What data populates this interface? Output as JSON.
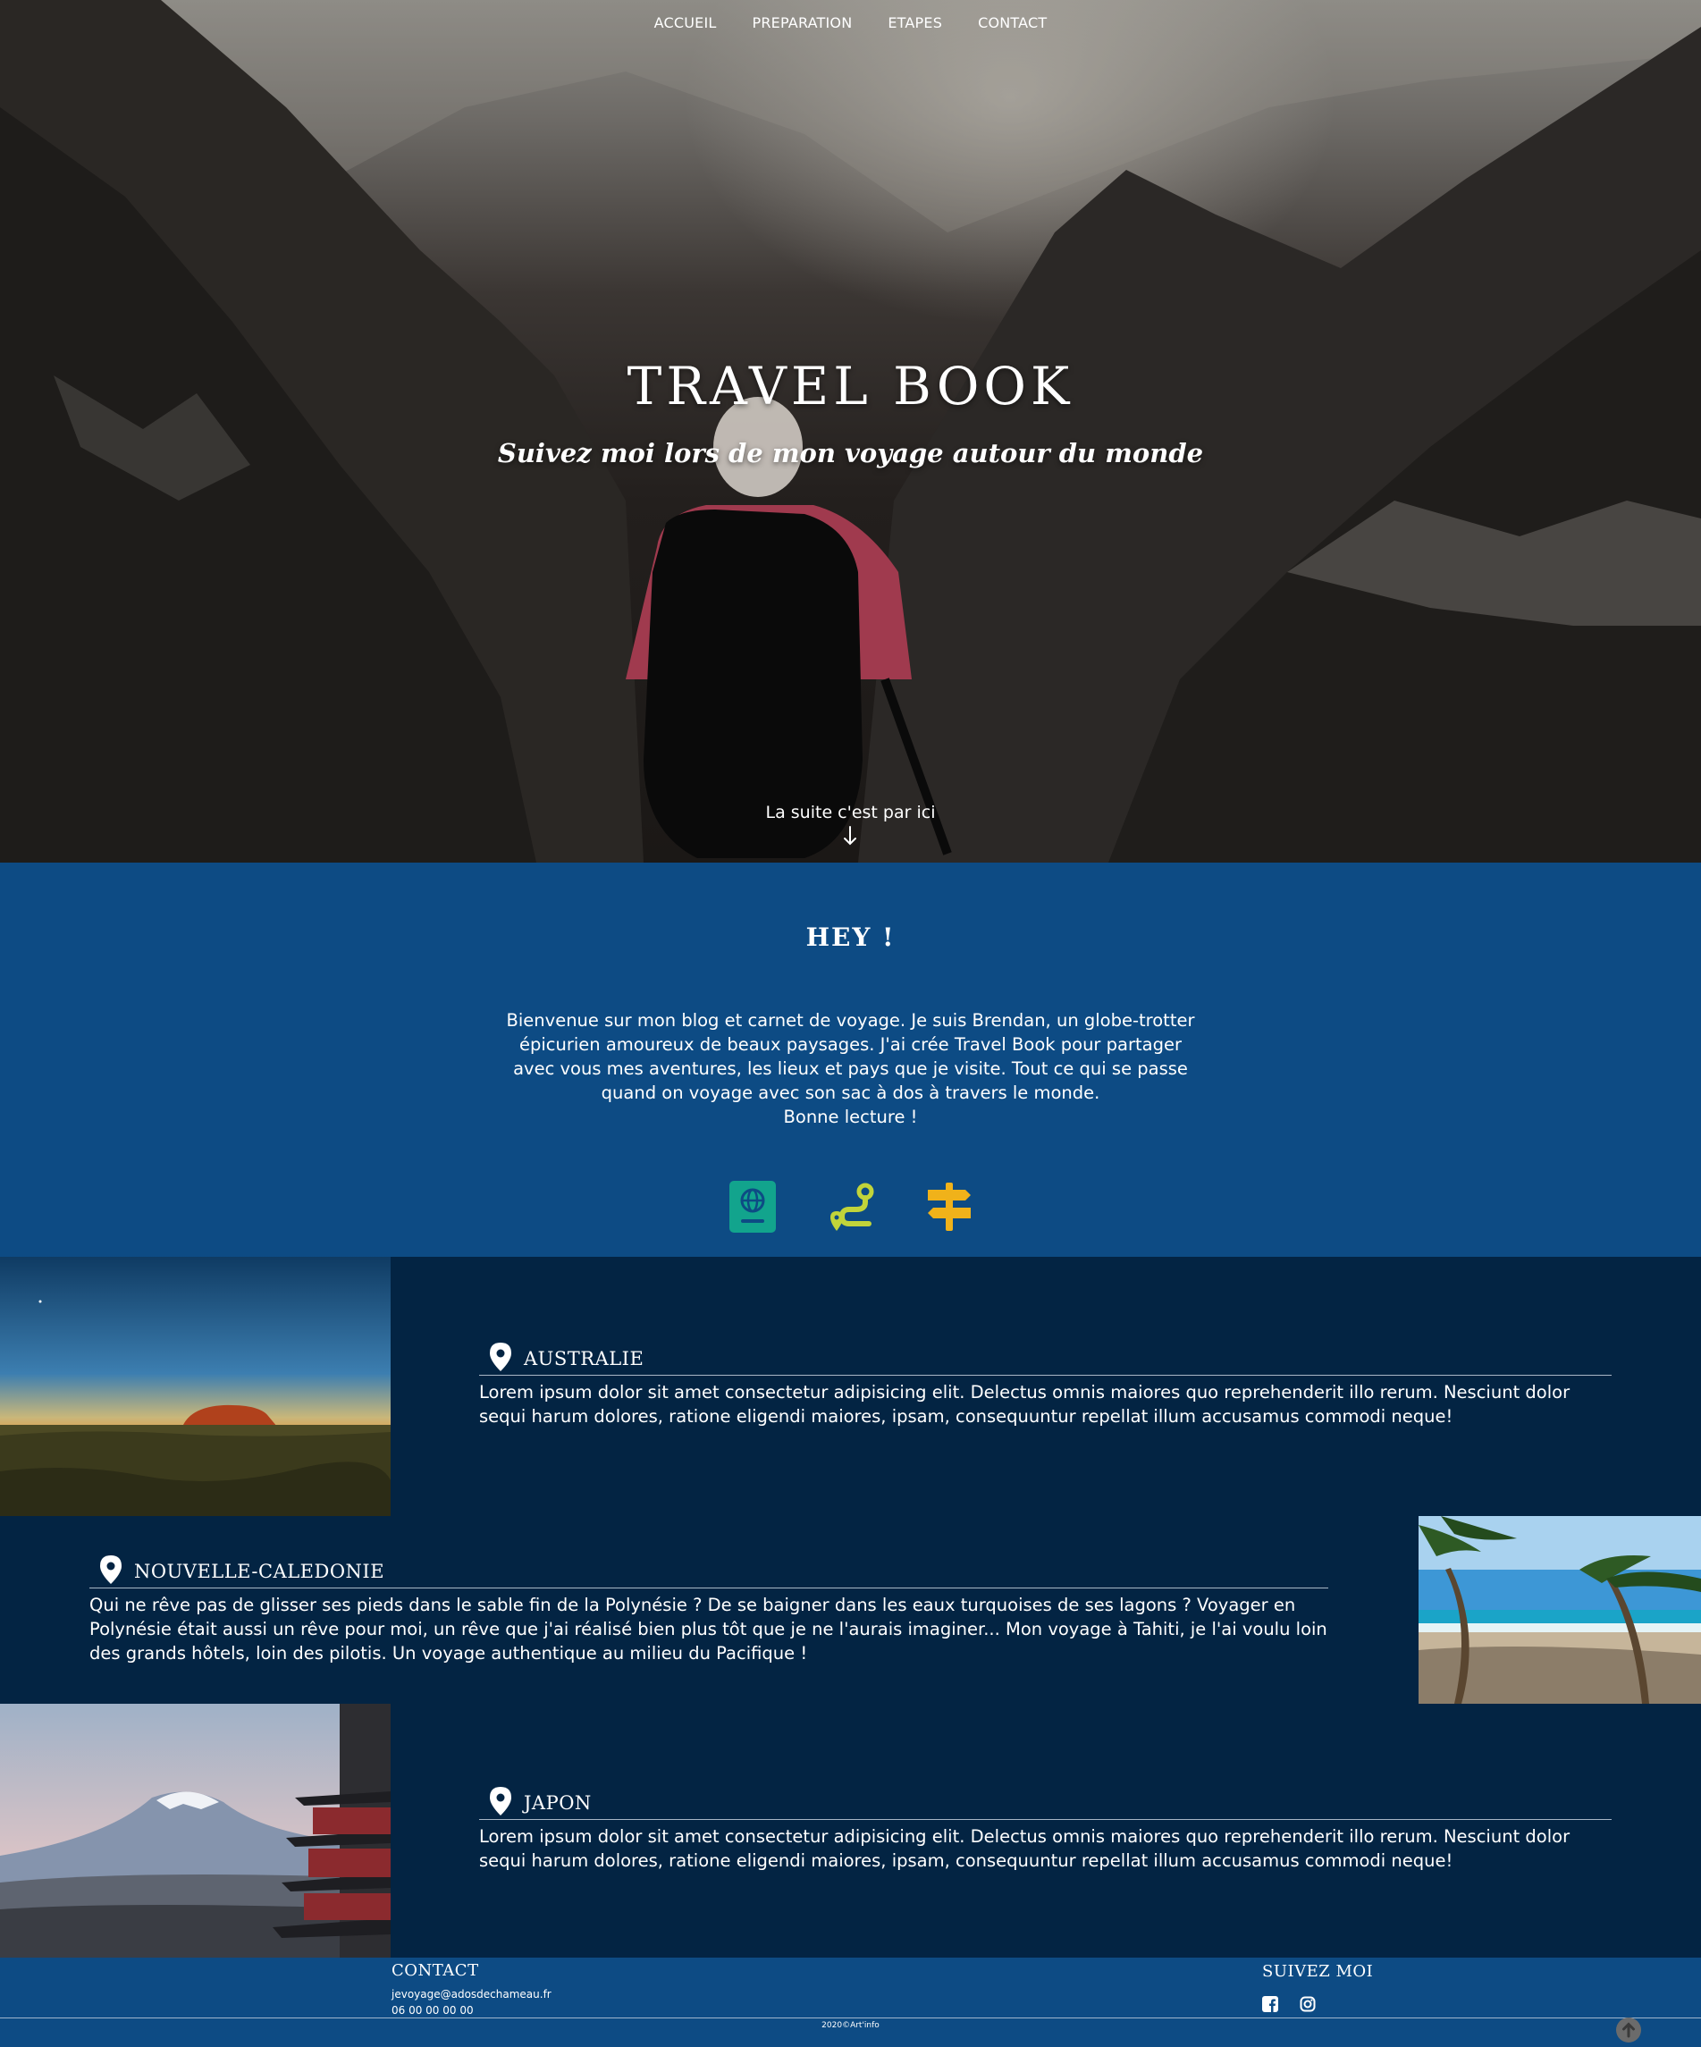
{
  "nav": {
    "items": [
      "ACCUEIL",
      "PREPARATION",
      "ETAPES",
      "CONTACT"
    ]
  },
  "hero": {
    "title": "TRAVEL BOOK",
    "subtitle": "Suivez moi lors de mon voyage autour du monde",
    "scroll_label": "La suite c'est par ici",
    "scroll_icon": "arrow-down-icon"
  },
  "intro": {
    "title": "HEY !",
    "paragraph": "Bienvenue sur mon blog et carnet de voyage. Je suis Brendan, un globe-trotter épicurien amoureux de beaux paysages. J'ai crée Travel Book pour partager avec vous mes aventures, les lieux et pays que je visite. Tout ce qui se passe quand on voyage avec son sac à dos à travers le monde.",
    "closing": "Bonne lecture !",
    "icons": [
      {
        "name": "passport-icon",
        "color": "#12a48d"
      },
      {
        "name": "route-icon",
        "color": "#c1d43a"
      },
      {
        "name": "signpost-icon",
        "color": "#f0b21a"
      }
    ]
  },
  "destinations": [
    {
      "name": "AUSTRALIE",
      "text": "Lorem ipsum dolor sit amet consectetur adipisicing elit. Delectus omnis maiores quo reprehenderit illo rerum. Nesciunt dolor sequi harum dolores, ratione eligendi maiores, ipsam, consequuntur repellat illum accusamus commodi neque!"
    },
    {
      "name": "NOUVELLE-CALEDONIE",
      "text": "Qui ne rêve pas de glisser ses pieds dans le sable fin de la Polynésie ? De se baigner dans les eaux turquoises de ses lagons ? Voyager en Polynésie était aussi un rêve pour moi, un rêve que j'ai réalisé bien plus tôt que je ne l'aurais imaginer... Mon voyage à Tahiti, je l'ai voulu loin des grands hôtels, loin des pilotis. Un voyage authentique au milieu du Pacifique !"
    },
    {
      "name": "JAPON",
      "text": "Lorem ipsum dolor sit amet consectetur adipisicing elit. Delectus omnis maiores quo reprehenderit illo rerum. Nesciunt dolor sequi harum dolores, ratione eligendi maiores, ipsam, consequuntur repellat illum accusamus commodi neque!"
    }
  ],
  "footer": {
    "contact_title": "CONTACT",
    "email": "jevoyage@adosdechameau.fr",
    "phone": "06 00 00 00 00",
    "follow_title": "SUIVEZ MOI",
    "social_icons": [
      "facebook-icon",
      "instagram-icon"
    ],
    "copyright": "2020©Art'info",
    "back_to_top_icon": "arrow-up-circle-icon"
  },
  "colors": {
    "intro_bg": "#0d4b84",
    "destinations_bg": "#032443",
    "footer_bg": "#0d4b84"
  }
}
